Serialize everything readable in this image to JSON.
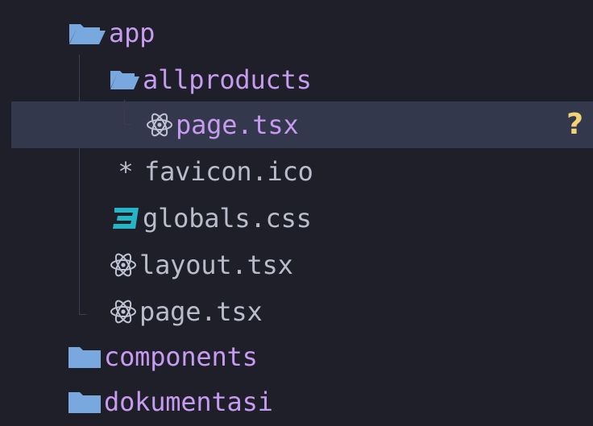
{
  "colors": {
    "background": "#1e1f29",
    "selected_row": "#33384d",
    "folder_text": "#c79bf0",
    "folder_icon": "#78a8de",
    "file_text": "#b9bccb",
    "file_text_selected": "#c79bf0",
    "react_icon": "#c0c3d4",
    "css_icon": "#26b5c7",
    "favicon_icon": "#b9bccb",
    "status_badge": "#f3d374",
    "guide_line": "#3c3f52"
  },
  "tree": {
    "app": {
      "label": "app",
      "icon": "folder-open-icon"
    },
    "allproducts": {
      "label": "allproducts",
      "icon": "folder-open-icon"
    },
    "allproducts_page": {
      "label": "page.tsx",
      "icon": "react-icon",
      "status": "?"
    },
    "favicon": {
      "label": "favicon.ico",
      "icon": "asterisk-icon",
      "glyph": "*"
    },
    "globals": {
      "label": "globals.css",
      "icon": "css-icon"
    },
    "layout": {
      "label": "layout.tsx",
      "icon": "react-icon"
    },
    "app_page": {
      "label": "page.tsx",
      "icon": "react-icon"
    },
    "components": {
      "label": "components",
      "icon": "folder-closed-icon"
    },
    "dokumentasi": {
      "label": "dokumentasi",
      "icon": "folder-closed-icon"
    }
  }
}
